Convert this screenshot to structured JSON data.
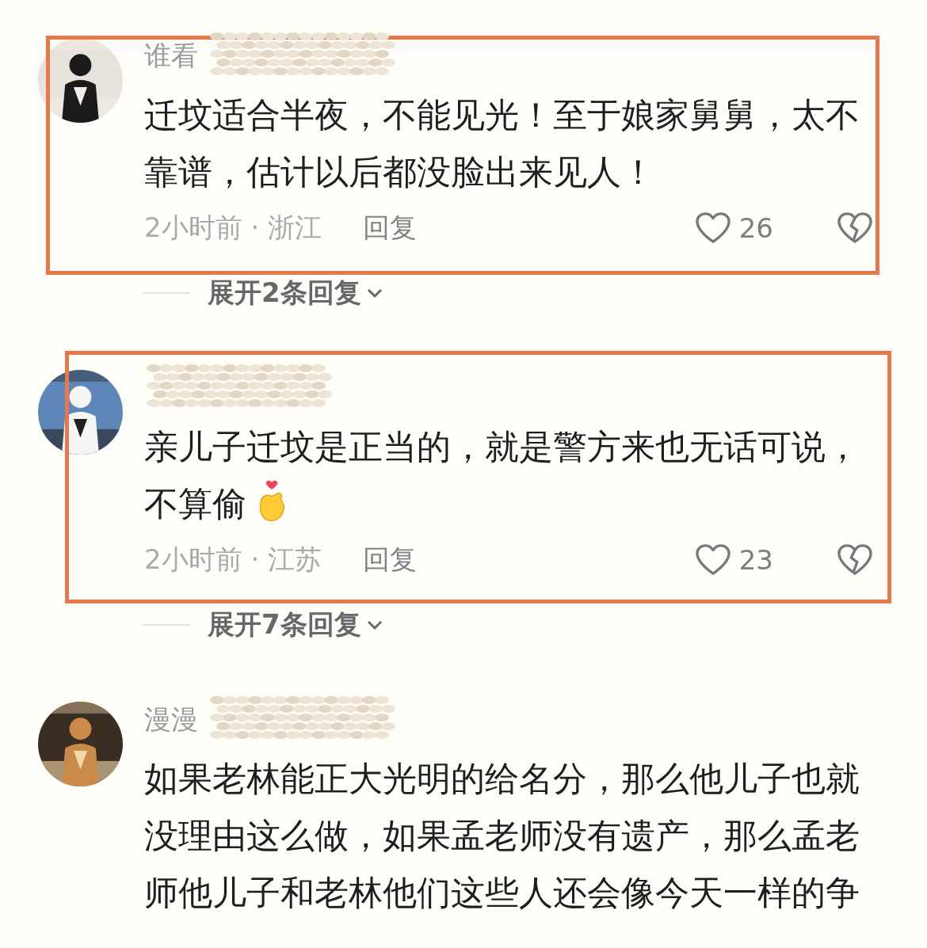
{
  "comments": [
    {
      "name": "谁看",
      "name_obscured": true,
      "text": "迁坟适合半夜，不能见光！至于娘家舅舅，太不靠谱，估计以后都没脸出来见人！",
      "trailing_emoji": false,
      "time": "2小时前 · 浙江",
      "reply": "回复",
      "likes": "26",
      "highlighted": true,
      "expand": "展开2条回复"
    },
    {
      "name_obscured": true,
      "text": "亲儿子迁坟是正当的，就是警方来也无话可说，不算偷",
      "trailing_emoji": true,
      "time": "2小时前 · 江苏",
      "reply": "回复",
      "likes": "23",
      "highlighted": true,
      "expand": "展开7条回复"
    },
    {
      "name": "漫漫",
      "name_obscured": true,
      "text": "如果老林能正大光明的给名分，那么他儿子也就没理由这么做，如果孟老师没有遗产，那么孟老师他儿子和老林他们这些人还会像今天一样的争",
      "trailing_emoji": false,
      "highlighted": false
    }
  ]
}
